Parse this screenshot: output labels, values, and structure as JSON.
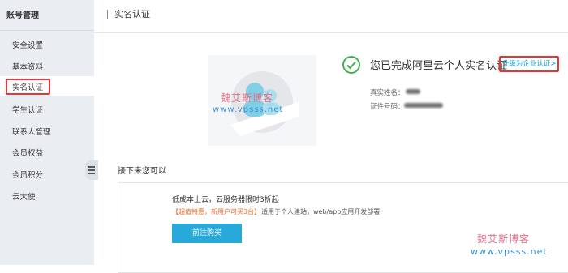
{
  "sidebar": {
    "title": "账号管理",
    "items": [
      {
        "label": "安全设置"
      },
      {
        "label": "基本资料"
      },
      {
        "label": "实名认证",
        "active": true
      },
      {
        "label": "学生认证"
      },
      {
        "label": "联系人管理"
      },
      {
        "label": "会员权益"
      },
      {
        "label": "会员积分"
      },
      {
        "label": "云大使"
      }
    ]
  },
  "header": {
    "title": "实名认证"
  },
  "verification": {
    "status_text": "您已完成阿里云个人实名认证",
    "upgrade_link": "升级为企业认证>",
    "name_label": "真实姓名：",
    "id_label": "证件号码："
  },
  "next": {
    "title": "接下来您可以",
    "promo_title": "低成本上云，云服务器限时3折起",
    "promo_tag": "【超值特惠，新用户可买3台】",
    "promo_desc": "适用于个人建站，web/app应用开发部署",
    "buy_button": "前往购买"
  },
  "watermark": {
    "line1": "魏艾斯博客",
    "line2": "www.vpsss.net"
  },
  "colors": {
    "accent": "#29a9d9",
    "highlight_border": "#ee3333",
    "success": "#3fb34f",
    "promo_orange": "#f06d2a",
    "sidebar_bg": "#eaedf1"
  },
  "icons": {
    "verified": "check-circle-icon",
    "collapse": "menu-collapse-icon",
    "illustration": "person-id-illustration"
  }
}
